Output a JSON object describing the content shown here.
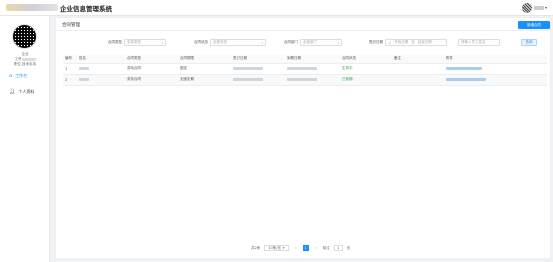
{
  "header": {
    "app_title": "企业信息管理系统",
    "user_caret": "▾"
  },
  "sidebar": {
    "profile_line1": "企业",
    "profile_line2": "工号",
    "profile_line3": "职位 技术支持",
    "menu": [
      {
        "label": "工作台",
        "icon": "home-icon",
        "active": true
      },
      {
        "label": "个人资料",
        "icon": "user-icon",
        "active": false
      }
    ]
  },
  "tab": {
    "label": "合同管理"
  },
  "toolbar": {
    "new_button": "新增合同"
  },
  "filters": {
    "type": {
      "label": "合同类型",
      "placeholder": "全部类型"
    },
    "status": {
      "label": "合同状态",
      "placeholder": "全部状态"
    },
    "dept": {
      "label": "合同部门",
      "placeholder": "全部部门"
    },
    "date": {
      "label": "签约日期",
      "start": "开始日期",
      "sep": "至",
      "end": "结束日期"
    },
    "search": {
      "placeholder": "请输入员工姓名"
    },
    "search_button": "查询"
  },
  "table": {
    "columns": [
      "编号",
      "姓名",
      "合同类型",
      "合同期限",
      "签订日期",
      "到期日期",
      "合同状态",
      "备注",
      "附件"
    ],
    "rows": [
      {
        "no": "1",
        "type": "劳动合同",
        "term": "固定",
        "status": "生效中"
      },
      {
        "no": "2",
        "type": "劳务合同",
        "term": "无固定期",
        "status": "已到期"
      }
    ]
  },
  "pagination": {
    "total": "共2条",
    "size": "10条/页",
    "prev": "‹",
    "current": "1",
    "next": "›",
    "goto_label": "前往",
    "goto_value": "1",
    "page_unit": "页"
  }
}
